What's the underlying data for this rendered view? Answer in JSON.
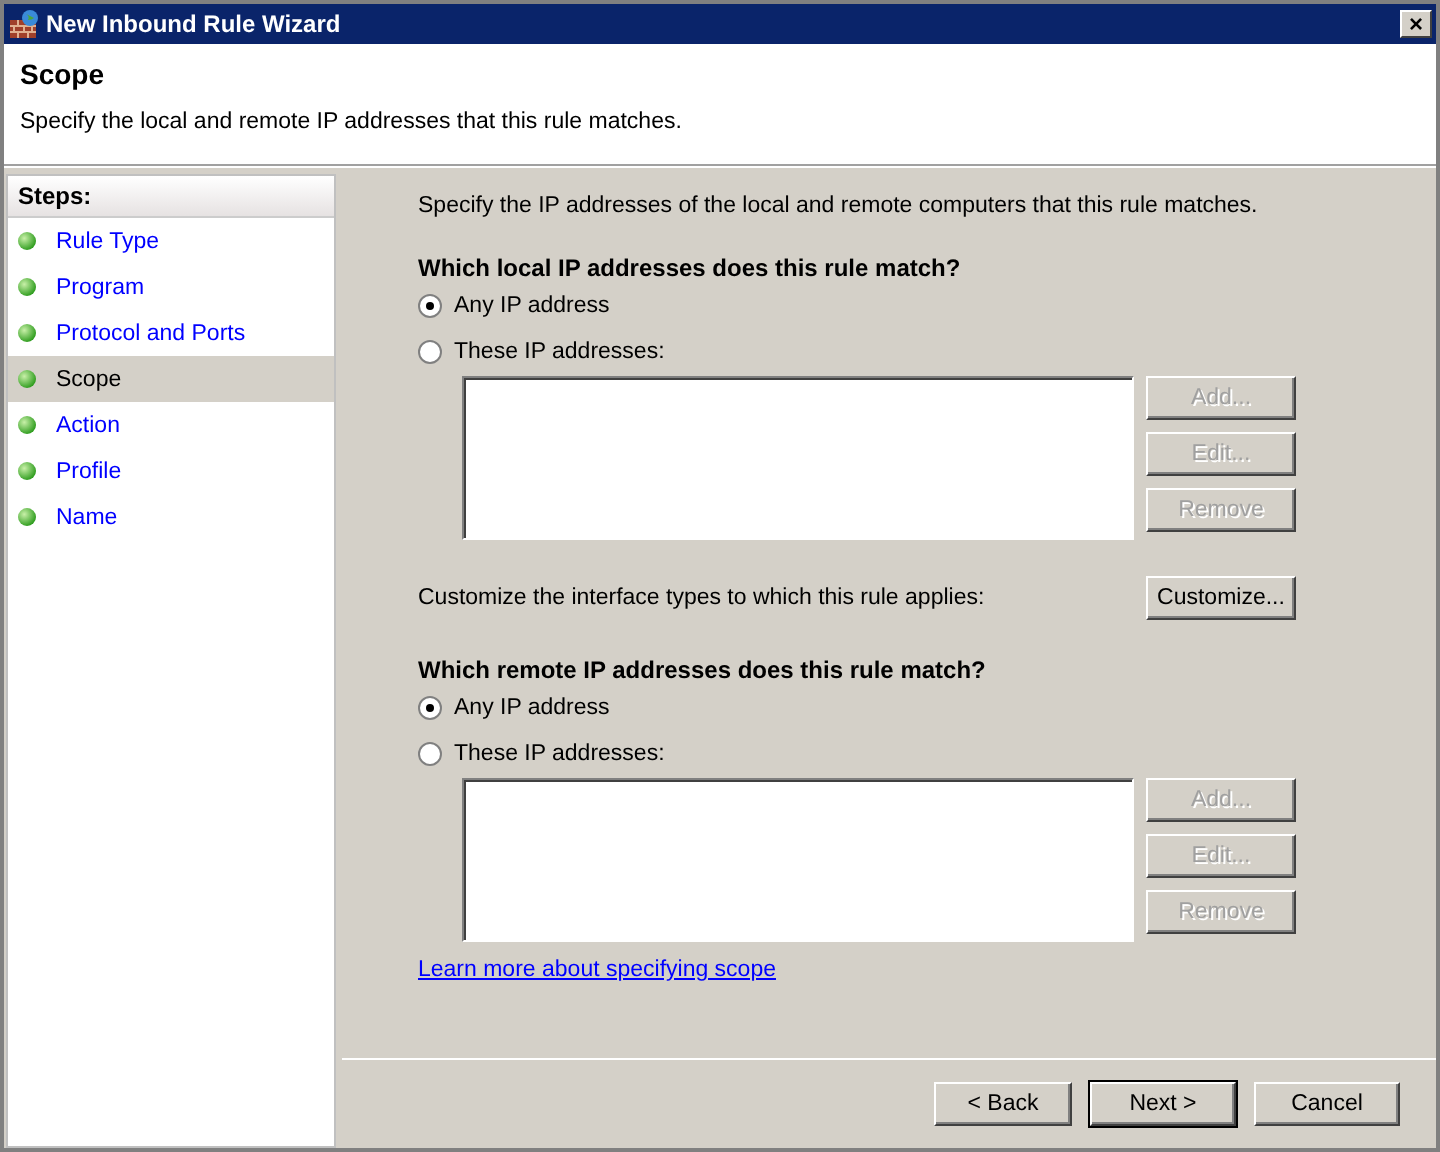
{
  "window": {
    "title": "New Inbound Rule Wizard",
    "close": "×"
  },
  "header": {
    "title": "Scope",
    "subtitle": "Specify the local and remote IP addresses that this rule matches."
  },
  "steps": {
    "heading": "Steps:",
    "items": [
      {
        "label": "Rule Type",
        "selected": false
      },
      {
        "label": "Program",
        "selected": false
      },
      {
        "label": "Protocol and Ports",
        "selected": false
      },
      {
        "label": "Scope",
        "selected": true
      },
      {
        "label": "Action",
        "selected": false
      },
      {
        "label": "Profile",
        "selected": false
      },
      {
        "label": "Name",
        "selected": false
      }
    ]
  },
  "intro": "Specify the IP addresses of the local and remote computers that this rule matches.",
  "local": {
    "heading": "Which local IP addresses does this rule match?",
    "options": [
      {
        "label": "Any IP address",
        "selected": true
      },
      {
        "label": "These IP addresses:",
        "selected": false
      }
    ],
    "buttons": [
      {
        "label": "Add...",
        "disabled": true
      },
      {
        "label": "Edit...",
        "disabled": true
      },
      {
        "label": "Remove",
        "disabled": true
      }
    ]
  },
  "customize": {
    "text": "Customize the interface types to which this rule applies:",
    "button": "Customize..."
  },
  "remote": {
    "heading": "Which remote IP addresses does this rule match?",
    "options": [
      {
        "label": "Any IP address",
        "selected": true
      },
      {
        "label": "These IP addresses:",
        "selected": false
      }
    ],
    "buttons": [
      {
        "label": "Add...",
        "disabled": true
      },
      {
        "label": "Edit...",
        "disabled": true
      },
      {
        "label": "Remove",
        "disabled": true
      }
    ]
  },
  "link": "Learn more about specifying scope",
  "footer": [
    {
      "label": "< Back",
      "default": false
    },
    {
      "label": "Next >",
      "default": true
    },
    {
      "label": "Cancel",
      "default": false
    }
  ]
}
